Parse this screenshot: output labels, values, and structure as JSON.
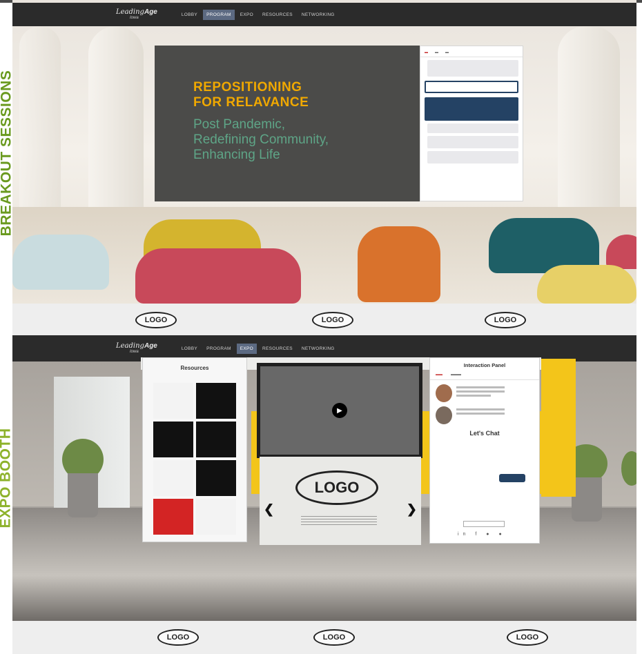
{
  "side_labels": {
    "top": "BREAKOUT SESSIONS",
    "bottom": "EXPO BOOTH"
  },
  "brand": {
    "name_italic": "Leading",
    "name_bold": "Age",
    "sub": "Iowa"
  },
  "nav_top": {
    "items": [
      "LOBBY",
      "PROGRAM",
      "EXPO",
      "RESOURCES",
      "NETWORKING"
    ],
    "active": "PROGRAM"
  },
  "nav_bottom": {
    "items": [
      "LOBBY",
      "PROGRAM",
      "EXPO",
      "RESOURCES",
      "NETWORKING"
    ],
    "active": "EXPO"
  },
  "session_screen": {
    "title_line1": "REPOSITIONING",
    "title_line2": "FOR RELAVANCE",
    "sub_line1": "Post Pandemic,",
    "sub_line2": "Redefining Community,",
    "sub_line3": "Enhancing Life"
  },
  "logo_label": "LOGO",
  "expo": {
    "resources_title": "Resources",
    "interaction_title": "Interaction Panel",
    "lets_chat": "Let's Chat",
    "booth_logo": "LOGO"
  },
  "colors": {
    "side_label": "#6a9a1f",
    "nav_bg": "#2b2b2b",
    "nav_active": "#5c6a82",
    "title_orange": "#f0a800",
    "subtitle_green": "#5ea587",
    "booth_yellow": "#f3c51a",
    "chat_blue": "#244264"
  }
}
